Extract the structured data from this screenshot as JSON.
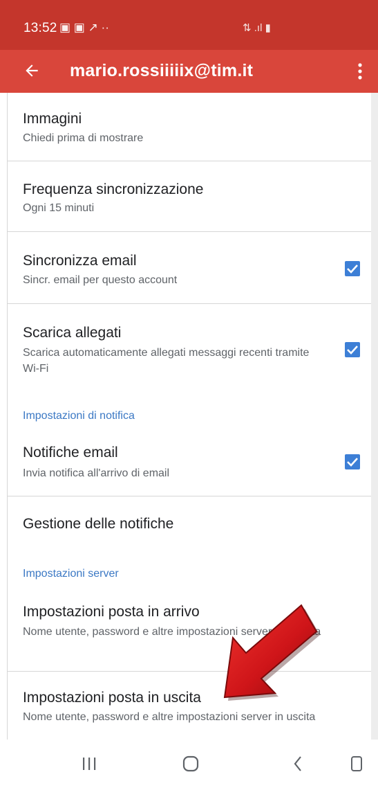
{
  "status_bar": {
    "time": "13:52",
    "left_icons": "▣ ▣ ↗ ··",
    "right_icons": "⇅ .ıl ▮"
  },
  "app_bar": {
    "back_icon": "arrow-back-icon",
    "title": "mario.rossiiiiix@tim.it",
    "menu_icon": "more-vert-icon"
  },
  "settings": [
    {
      "title": "Immagini",
      "summary": "Chiedi prima di mostrare"
    },
    {
      "title": "Frequenza sincronizzazione",
      "summary": "Ogni 15 minuti"
    },
    {
      "title": "Sincronizza email",
      "summary": "Sincr. email per questo account",
      "checked": true
    },
    {
      "title": "Scarica allegati",
      "summary": "Scarica automaticamente allegati messaggi recenti tramite Wi-Fi",
      "checked": true
    },
    {
      "header": "Impostazioni di notifica"
    },
    {
      "title": "Notifiche email",
      "summary": "Invia notifica all'arrivo di email",
      "checked": true
    },
    {
      "title": "Gestione delle notifiche"
    },
    {
      "header": "Impostazioni server"
    },
    {
      "title": "Impostazioni posta in arrivo",
      "summary": "Nome utente, password e altre impostazioni server in entrata"
    },
    {
      "title": "Impostazioni posta in uscita",
      "summary": "Nome utente, password e altre impostazioni server in uscita"
    }
  ],
  "nav_bar": {
    "recents_icon": "recents-icon",
    "home_icon": "home-icon",
    "back_icon": "nav-back-icon",
    "extra_icon": "phone-icon"
  },
  "colors": {
    "status_bar": "#c4362c",
    "app_bar": "#d9463b",
    "accent": "#3d7fd6",
    "header_text": "#3b78c4",
    "arrow": "#d0141b"
  }
}
